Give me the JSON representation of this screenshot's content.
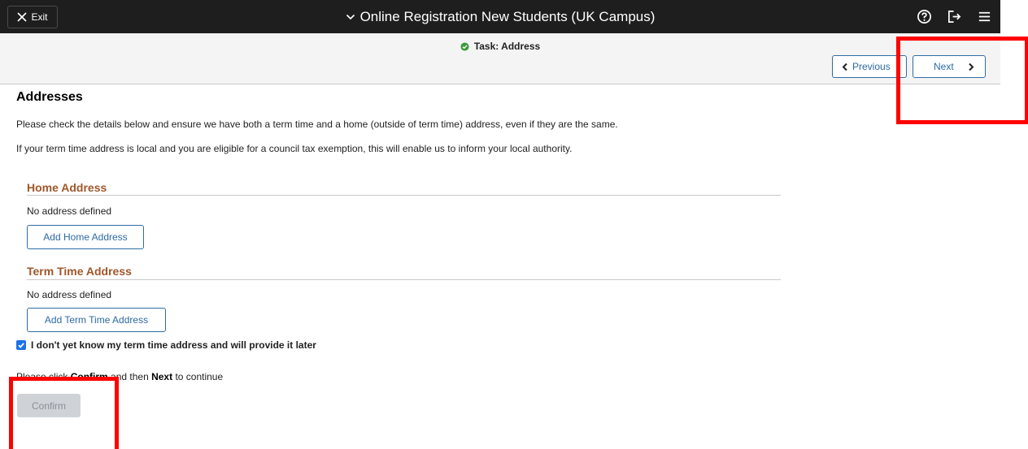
{
  "topbar": {
    "exit_label": "Exit",
    "title": "Online Registration New Students (UK Campus)",
    "icons": [
      "help-icon",
      "sign-out-icon",
      "menu-icon"
    ]
  },
  "subheader": {
    "task_title": "Task: Address",
    "previous_label": "Previous",
    "next_label": "Next"
  },
  "main": {
    "heading": "Addresses",
    "intro_1": "Please check the details below and ensure we have both a term time and a home (outside of term time) address, even if they are the same.",
    "intro_2": "If your term time address is local and you are eligible for a council tax exemption, this will enable us to inform your local authority.",
    "home": {
      "title": "Home Address",
      "status": "No address defined",
      "button": "Add Home Address"
    },
    "term": {
      "title": "Term Time Address",
      "status": "No address defined",
      "button": "Add Term Time Address"
    },
    "checkbox_label": "I don't yet know my term time address and will provide it later",
    "checkbox_checked": true,
    "instruction_prefix": "Please click ",
    "instruction_confirm": "Confirm",
    "instruction_middle": " and then ",
    "instruction_next": "Next",
    "instruction_suffix": " to continue",
    "confirm_label": "Confirm"
  },
  "colors": {
    "topbar": "#1e1e1e",
    "link_blue": "#2d6aa3",
    "section_title": "#a0572a",
    "highlight": "#ff0000",
    "success_green": "#3c9a3c"
  }
}
